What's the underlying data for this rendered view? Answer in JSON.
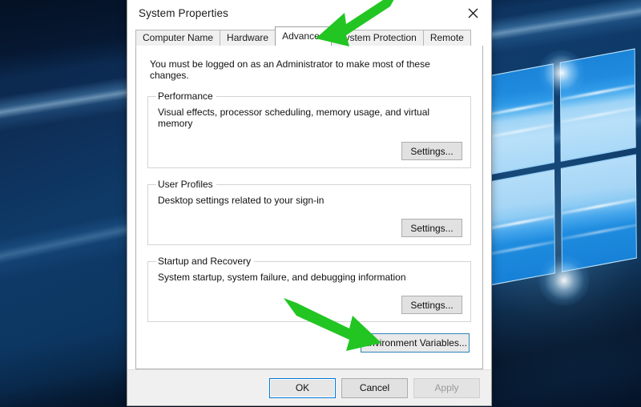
{
  "desktop": {
    "wallpaper_name": "windows-10-hero-wallpaper",
    "accent_blue": "#0f3a68",
    "logo_light": "#b9e0f9",
    "logo_mid": "#1f8ade"
  },
  "window": {
    "title": "System Properties",
    "close_icon": "close-icon"
  },
  "tabs": [
    {
      "label": "Computer Name",
      "selected": false
    },
    {
      "label": "Hardware",
      "selected": false
    },
    {
      "label": "Advanced",
      "selected": true
    },
    {
      "label": "System Protection",
      "selected": false
    },
    {
      "label": "Remote",
      "selected": false
    }
  ],
  "panel": {
    "admin_note": "You must be logged on as an Administrator to make most of these changes.",
    "groups": [
      {
        "legend": "Performance",
        "description": "Visual effects, processor scheduling, memory usage, and virtual memory",
        "button": "Settings..."
      },
      {
        "legend": "User Profiles",
        "description": "Desktop settings related to your sign-in",
        "button": "Settings..."
      },
      {
        "legend": "Startup and Recovery",
        "description": "System startup, system failure, and debugging information",
        "button": "Settings..."
      }
    ],
    "environment_variables_button": "Environment Variables..."
  },
  "footer": {
    "ok": "OK",
    "cancel": "Cancel",
    "apply": "Apply",
    "apply_disabled": true
  },
  "annotations": {
    "color": "#22c522",
    "arrows": [
      {
        "name": "arrow-pointing-to-advanced-tab",
        "target": "Advanced"
      },
      {
        "name": "arrow-pointing-to-environment-variables-button",
        "target": "Environment Variables..."
      }
    ]
  }
}
